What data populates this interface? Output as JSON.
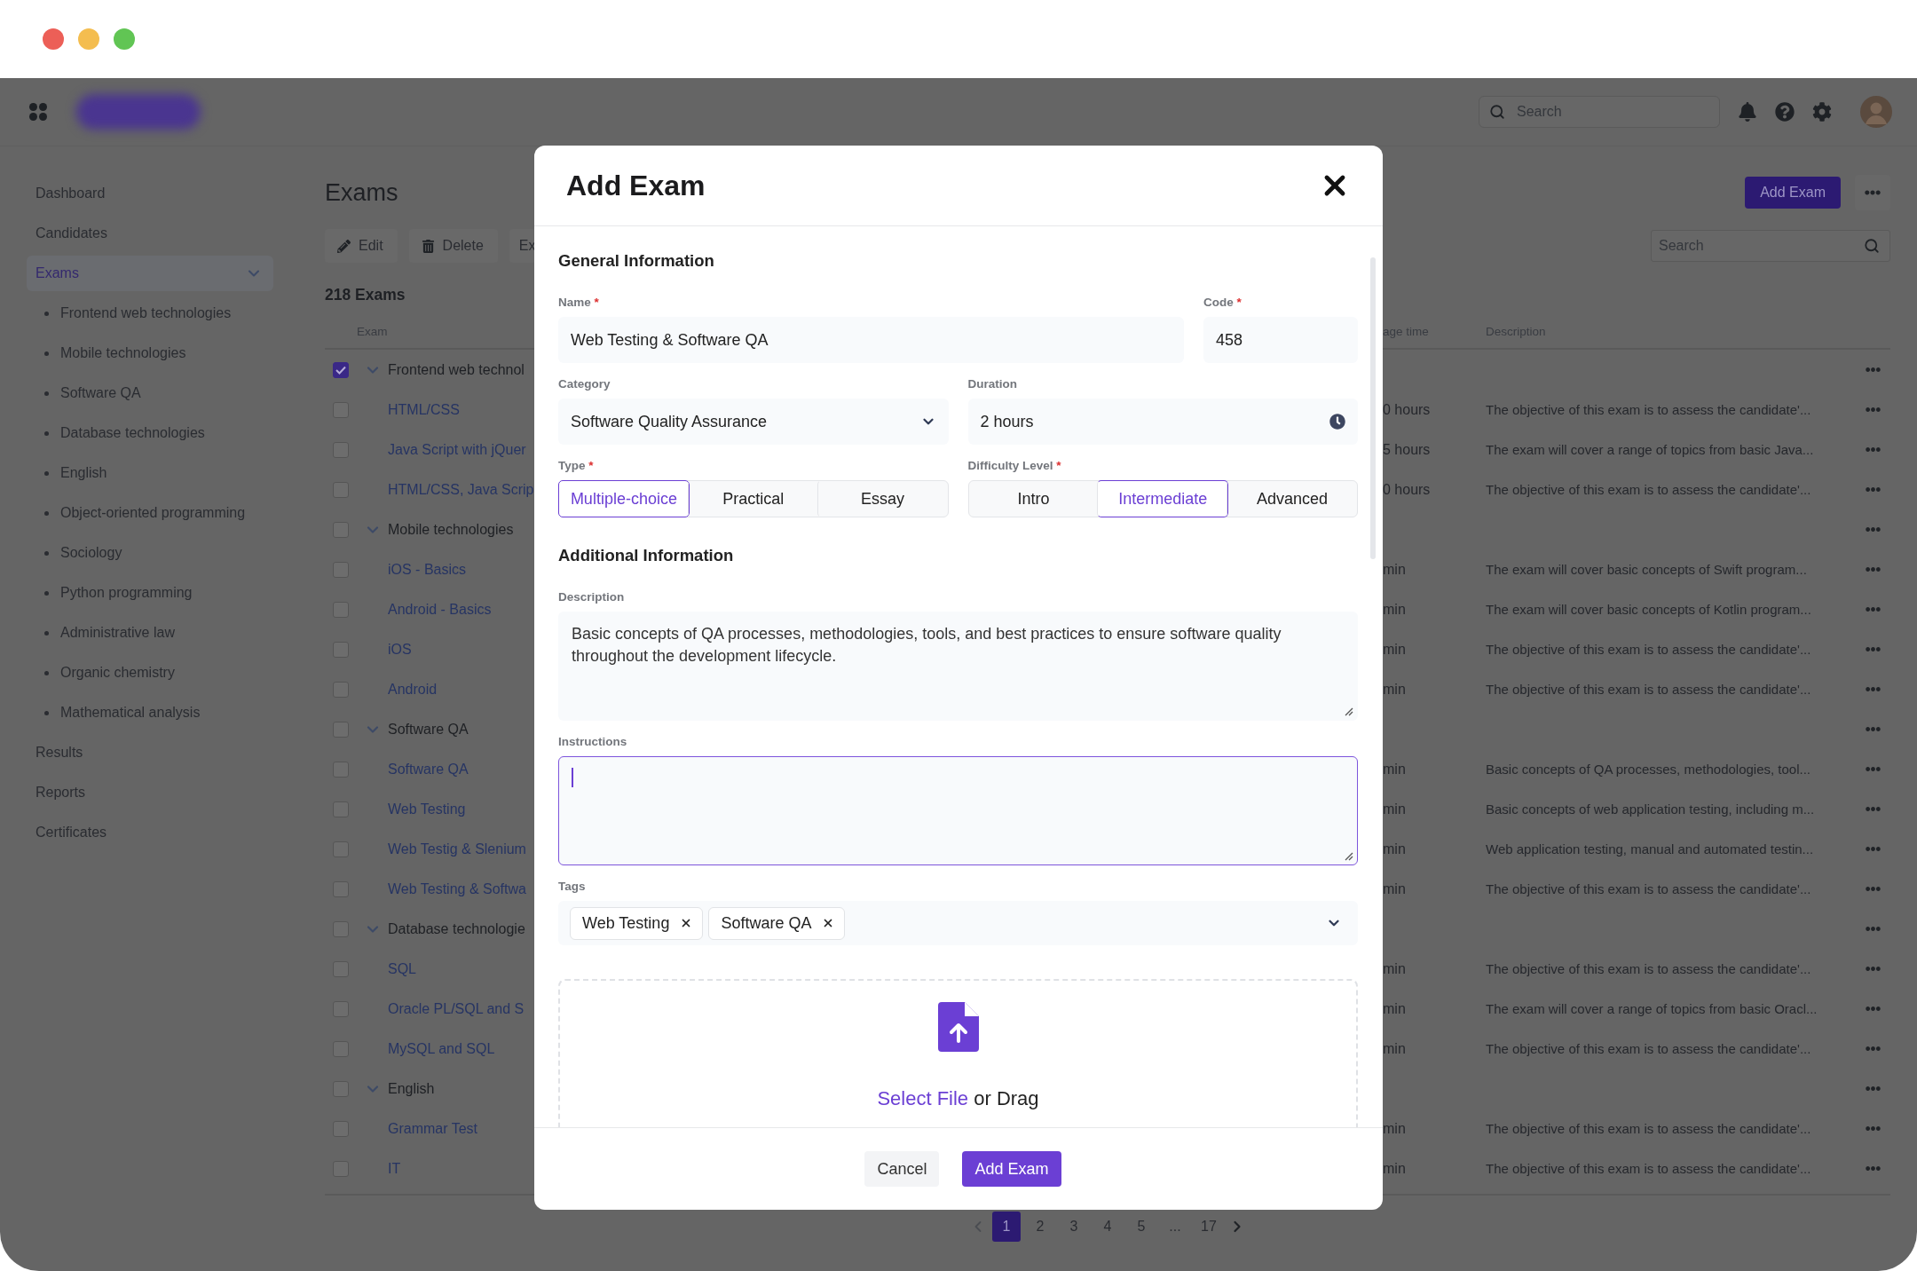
{
  "header": {
    "search": {
      "placeholder": "Search"
    }
  },
  "sidebar": {
    "items": [
      {
        "label": "Dashboard",
        "selected": false
      },
      {
        "label": "Candidates",
        "selected": false
      },
      {
        "label": "Exams",
        "selected": true,
        "expanded": true,
        "children": [
          {
            "label": "Frontend web technologies",
            "selected": false
          },
          {
            "label": "Mobile technologies",
            "selected": false
          },
          {
            "label": "Software QA",
            "selected": false
          },
          {
            "label": "Database technologies",
            "selected": false
          },
          {
            "label": "English",
            "selected": false
          },
          {
            "label": "Object-oriented programming",
            "selected": false
          },
          {
            "label": "Sociology",
            "selected": false
          },
          {
            "label": "Python programming",
            "selected": false
          },
          {
            "label": "Administrative law",
            "selected": false
          },
          {
            "label": "Organic chemistry",
            "selected": false
          },
          {
            "label": "Mathematical analysis",
            "selected": false
          }
        ]
      },
      {
        "label": "Results",
        "selected": false
      },
      {
        "label": "Reports",
        "selected": false
      },
      {
        "label": "Certificates",
        "selected": false
      }
    ]
  },
  "page": {
    "title": "Exams",
    "add_button": "Add Exam",
    "toolbar": [
      {
        "label": "Edit"
      },
      {
        "label": "Delete"
      },
      {
        "label": "Ex"
      }
    ],
    "search": {
      "placeholder": "Search"
    },
    "count": "218 Exams"
  },
  "table": {
    "columns": [
      "Exam",
      "age time",
      "Description"
    ],
    "rows": [
      {
        "kind": "group",
        "name": "Frontend web technol",
        "checked": true,
        "expanded": true
      },
      {
        "kind": "exam",
        "name": "HTML/CSS",
        "checked": false,
        "time": "0 hours",
        "description": "The objective of this exam is to assess the candidate'..."
      },
      {
        "kind": "exam",
        "name": "Java Script with jQuer",
        "checked": false,
        "time": "5 hours",
        "description": "The exam will cover a range of topics from basic Java..."
      },
      {
        "kind": "exam",
        "name": "HTML/CSS, Java Scrip",
        "checked": false,
        "time": "0 hours",
        "description": "The objective of this exam is to assess the candidate'..."
      },
      {
        "kind": "group",
        "name": "Mobile technologies",
        "checked": false,
        "expanded": true
      },
      {
        "kind": "exam",
        "name": "iOS - Basics",
        "checked": false,
        "time": "min",
        "description": "The exam will cover basic concepts of Swift program..."
      },
      {
        "kind": "exam",
        "name": "Android - Basics",
        "checked": false,
        "time": "min",
        "description": "The exam will cover basic concepts of Kotlin program..."
      },
      {
        "kind": "exam",
        "name": "iOS",
        "checked": false,
        "time": "min",
        "description": "The objective of this exam is to assess the candidate'..."
      },
      {
        "kind": "exam",
        "name": "Android",
        "checked": false,
        "time": "min",
        "description": "The objective of this exam is to assess the candidate'..."
      },
      {
        "kind": "group",
        "name": "Software QA",
        "checked": false,
        "expanded": true
      },
      {
        "kind": "exam",
        "name": "Software QA",
        "checked": false,
        "time": "min",
        "description": "Basic concepts of QA processes, methodologies, tool..."
      },
      {
        "kind": "exam",
        "name": "Web Testing",
        "checked": false,
        "time": "min",
        "description": "Basic concepts of web application testing, including m..."
      },
      {
        "kind": "exam",
        "name": "Web Testig & Slenium",
        "checked": false,
        "time": "min",
        "description": "Web application testing, manual and automated testin..."
      },
      {
        "kind": "exam",
        "name": "Web Testing & Softwa",
        "checked": false,
        "time": "min",
        "description": "The objective of this exam is to assess the candidate'..."
      },
      {
        "kind": "group",
        "name": "Database technologie",
        "checked": false,
        "expanded": true
      },
      {
        "kind": "exam",
        "name": "SQL",
        "checked": false,
        "time": "min",
        "description": "The objective of this exam is to assess the candidate'..."
      },
      {
        "kind": "exam",
        "name": "Oracle PL/SQL and S",
        "checked": false,
        "time": "min",
        "description": "The exam will cover a range of topics from basic Oracl..."
      },
      {
        "kind": "exam",
        "name": "MySQL and SQL",
        "checked": false,
        "time": "min",
        "description": "The objective of this exam is to assess the candidate'..."
      },
      {
        "kind": "group",
        "name": "English",
        "checked": false,
        "expanded": true
      },
      {
        "kind": "exam",
        "name": "Grammar Test",
        "checked": false,
        "time": "min",
        "description": "The objective of this exam is to assess the candidate'..."
      },
      {
        "kind": "exam",
        "name": "IT",
        "checked": false,
        "time": "min",
        "description": "The objective of this exam is to assess the candidate'..."
      }
    ]
  },
  "pagination": {
    "pages": [
      {
        "label": "1",
        "selected": true
      },
      {
        "label": "2",
        "selected": false
      },
      {
        "label": "3",
        "selected": false
      },
      {
        "label": "4",
        "selected": false
      },
      {
        "label": "5",
        "selected": false
      },
      {
        "label": "...",
        "selected": false
      },
      {
        "label": "17",
        "selected": false
      }
    ]
  },
  "dialog": {
    "title": "Add Exam",
    "general_heading": "General Information",
    "name": {
      "label": "Name",
      "required_mark": "*",
      "value": "Web Testing & Software QA"
    },
    "code": {
      "label": "Code",
      "required_mark": "*",
      "value": "458"
    },
    "category": {
      "label": "Category",
      "value": "Software Quality Assurance"
    },
    "duration": {
      "label": "Duration",
      "value": "2 hours"
    },
    "type": {
      "label": "Type",
      "required_mark": "*",
      "options": [
        {
          "label": "Multiple-choice",
          "selected": true
        },
        {
          "label": "Practical",
          "selected": false
        },
        {
          "label": "Essay",
          "selected": false
        }
      ]
    },
    "difficulty": {
      "label": "Difficulty Level",
      "required_mark": "*",
      "options": [
        {
          "label": "Intro",
          "selected": false
        },
        {
          "label": "Intermediate",
          "selected": true
        },
        {
          "label": "Advanced",
          "selected": false
        }
      ]
    },
    "additional_heading": "Additional Information",
    "description": {
      "label": "Description",
      "value": "Basic concepts of QA processes, methodologies, tools, and best practices to ensure software quality throughout the development lifecycle."
    },
    "instructions": {
      "label": "Instructions",
      "focused": true
    },
    "tags": {
      "label": "Tags",
      "items": [
        "Web Testing",
        "Software QA"
      ]
    },
    "upload": {
      "link": "Select File",
      "text": "or Drag"
    },
    "cancel": "Cancel",
    "submit": "Add Exam"
  }
}
